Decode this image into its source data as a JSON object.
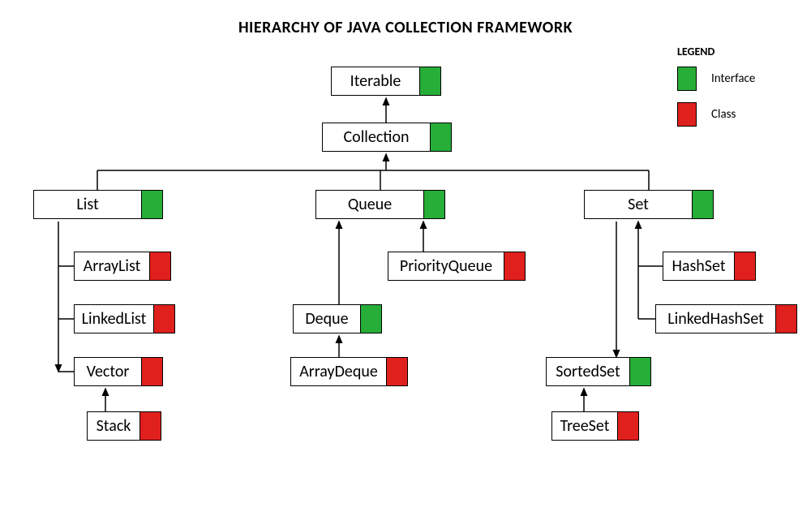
{
  "title": "HIERARCHY OF JAVA COLLECTION FRAMEWORK",
  "legend": {
    "title": "LEGEND",
    "interface": "Interface",
    "class": "Class"
  },
  "nodes": {
    "iterable": "Iterable",
    "collection": "Collection",
    "list": "List",
    "queue": "Queue",
    "set": "Set",
    "arraylist": "ArrayList",
    "linkedlist": "LinkedList",
    "vector": "Vector",
    "stack": "Stack",
    "priorityqueue": "PriorityQueue",
    "deque": "Deque",
    "arraydeque": "ArrayDeque",
    "hashset": "HashSet",
    "linkedhashset": "LinkedHashSet",
    "sortedset": "SortedSet",
    "treeset": "TreeSet"
  },
  "chart_data": {
    "type": "tree",
    "title": "HIERARCHY OF JAVA COLLECTION FRAMEWORK",
    "legend": {
      "interface_color": "#27ae38",
      "class_color": "#e0201d"
    },
    "nodes": [
      {
        "id": "Iterable",
        "kind": "interface"
      },
      {
        "id": "Collection",
        "kind": "interface",
        "parent": "Iterable"
      },
      {
        "id": "List",
        "kind": "interface",
        "parent": "Collection"
      },
      {
        "id": "Queue",
        "kind": "interface",
        "parent": "Collection"
      },
      {
        "id": "Set",
        "kind": "interface",
        "parent": "Collection"
      },
      {
        "id": "ArrayList",
        "kind": "class",
        "parent": "List"
      },
      {
        "id": "LinkedList",
        "kind": "class",
        "parent": "List"
      },
      {
        "id": "Vector",
        "kind": "class",
        "parent": "List"
      },
      {
        "id": "Stack",
        "kind": "class",
        "parent": "Vector"
      },
      {
        "id": "PriorityQueue",
        "kind": "class",
        "parent": "Queue"
      },
      {
        "id": "Deque",
        "kind": "interface",
        "parent": "Queue"
      },
      {
        "id": "ArrayDeque",
        "kind": "class",
        "parent": "Deque"
      },
      {
        "id": "HashSet",
        "kind": "class",
        "parent": "Set"
      },
      {
        "id": "LinkedHashSet",
        "kind": "class",
        "parent": "Set"
      },
      {
        "id": "SortedSet",
        "kind": "interface",
        "parent": "Set"
      },
      {
        "id": "TreeSet",
        "kind": "class",
        "parent": "SortedSet"
      }
    ]
  }
}
